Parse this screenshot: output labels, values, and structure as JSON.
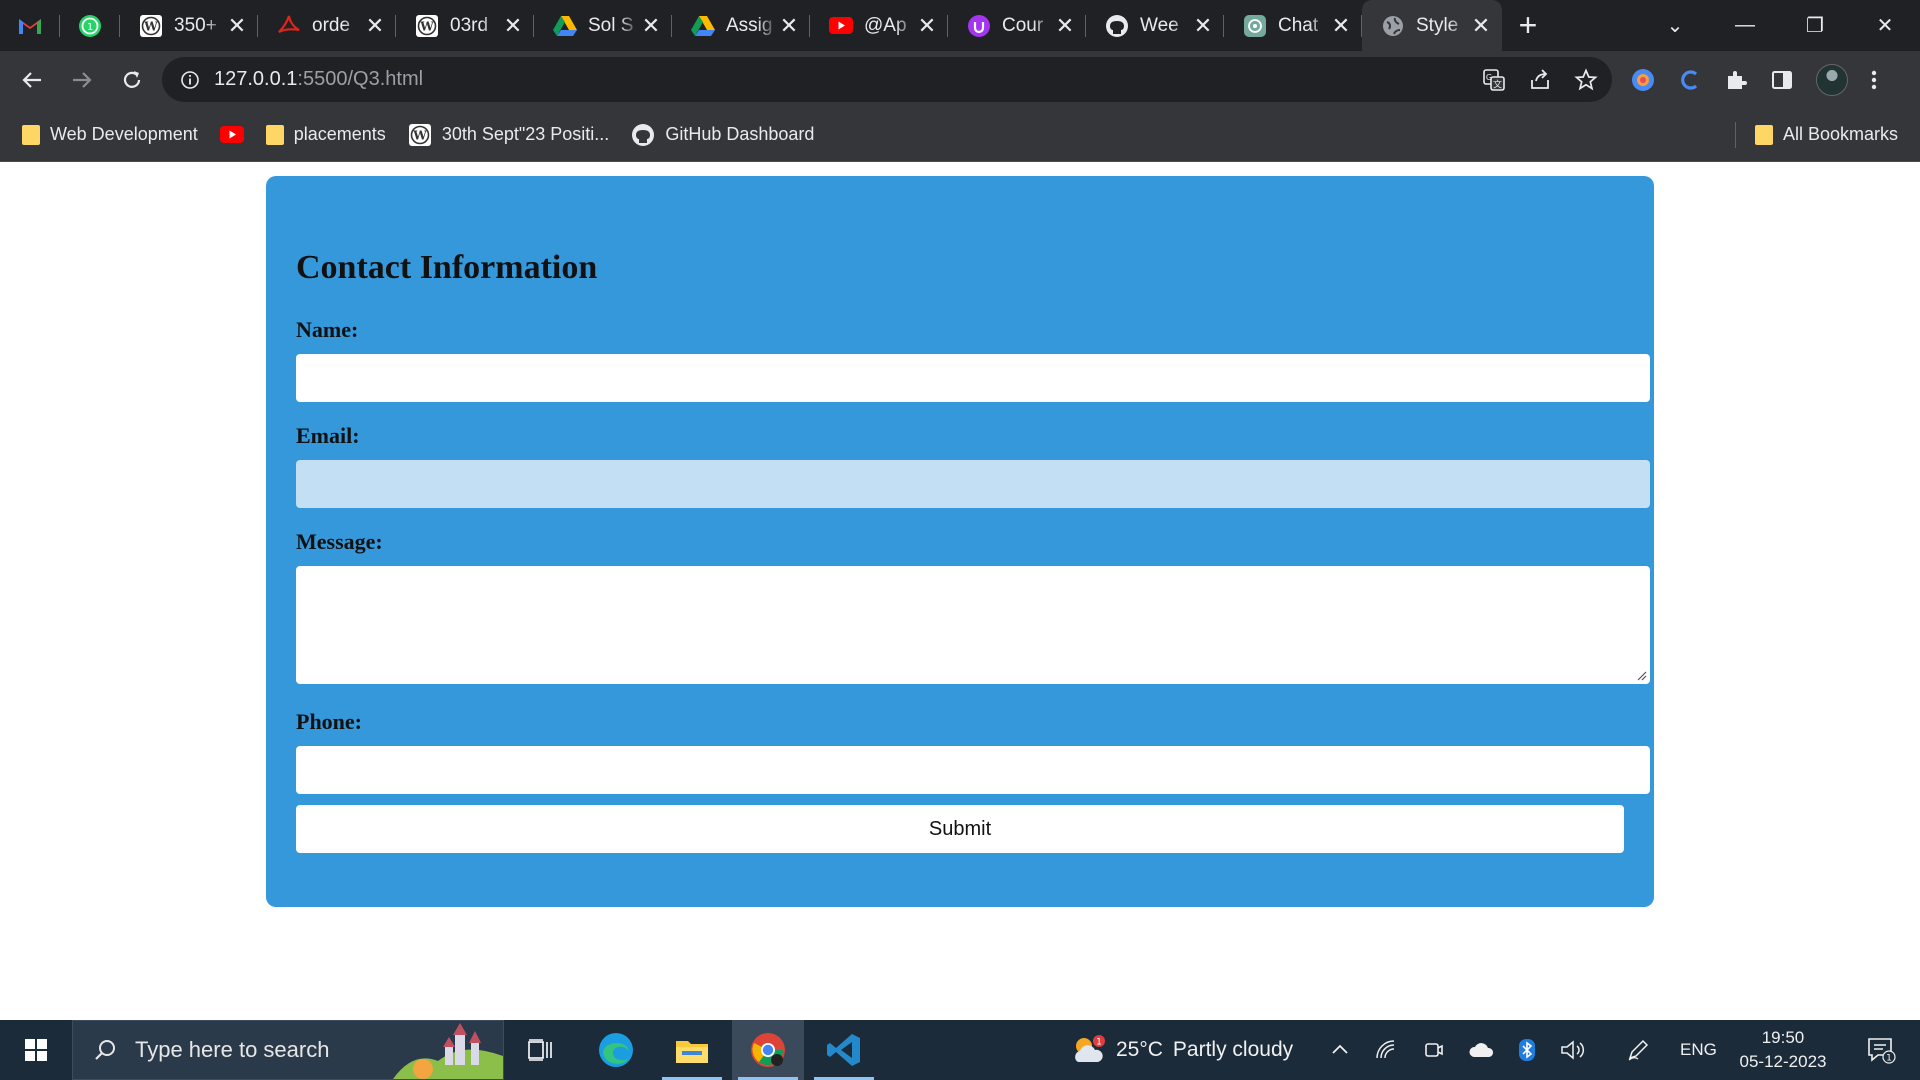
{
  "browser": {
    "pinned_tabs": [
      {
        "name": "gmail"
      },
      {
        "name": "whatsapp"
      }
    ],
    "tabs": [
      {
        "title": "350+",
        "icon": "wordpress-icon"
      },
      {
        "title": "orde",
        "icon": "pdf-icon"
      },
      {
        "title": "03rd",
        "icon": "wordpress-icon"
      },
      {
        "title": "Sol S",
        "icon": "drive-icon"
      },
      {
        "title": "Assig",
        "icon": "drive-icon"
      },
      {
        "title": "@Ap",
        "icon": "youtube-icon"
      },
      {
        "title": "Cour",
        "icon": "udemy-icon"
      },
      {
        "title": "Wee",
        "icon": "github-icon"
      },
      {
        "title": "Chat",
        "icon": "chatgpt-icon"
      },
      {
        "title": "Style",
        "icon": "globe-icon",
        "active": true
      }
    ],
    "url_host": "127.0.0.1",
    "url_path": ":5500/Q3.html",
    "bookmarks": [
      {
        "label": "Web Development",
        "icon": "folder-icon"
      },
      {
        "label": "",
        "icon": "youtube-icon"
      },
      {
        "label": "placements",
        "icon": "folder-icon"
      },
      {
        "label": "30th Sept\"23 Positi...",
        "icon": "wordpress-icon"
      },
      {
        "label": "GitHub Dashboard",
        "icon": "github-icon"
      }
    ],
    "all_bookmarks": "All Bookmarks"
  },
  "form": {
    "title": "Contact Information",
    "name_label": "Name:",
    "name_value": "",
    "email_label": "Email:",
    "email_value": "",
    "message_label": "Message:",
    "message_value": "",
    "phone_label": "Phone:",
    "phone_value": "",
    "submit_label": "Submit",
    "card_color": "#3498db",
    "focused_field_color": "#c3dff3"
  },
  "taskbar": {
    "search_placeholder": "Type here to search",
    "apps": [
      "task-view",
      "edge",
      "file-explorer",
      "chrome",
      "vscode"
    ],
    "weather_temp": "25°C",
    "weather_desc": "Partly cloudy",
    "weather_badge": "1",
    "language": "ENG",
    "time": "19:50",
    "date": "05-12-2023",
    "notification_count": "1"
  }
}
